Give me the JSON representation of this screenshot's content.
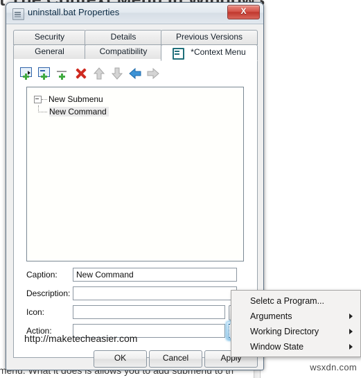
{
  "background": {
    "heading": "it The Context Menu In Windows",
    "body": "t menu. What it does is allows you to add submenu to th",
    "watermark": "wsxdn.com"
  },
  "dialog": {
    "title": "uninstall.bat Properties",
    "title_icon": "script-file-icon",
    "close_label": "X",
    "tabs_row1": [
      {
        "label": "Security",
        "active": false
      },
      {
        "label": "Details",
        "active": false
      },
      {
        "label": "Previous Versions",
        "active": false
      }
    ],
    "tabs_row2": [
      {
        "label": "General",
        "active": false
      },
      {
        "label": "Compatibility",
        "active": false
      },
      {
        "label": "*Context Menu",
        "active": true,
        "icon": "context-menu-icon"
      }
    ],
    "toolbar": [
      {
        "name": "add-submenu-button",
        "tooltip": "Add Submenu",
        "enabled": true
      },
      {
        "name": "add-command-button",
        "tooltip": "Add Command",
        "enabled": true
      },
      {
        "name": "add-separator-button",
        "tooltip": "Add Separator",
        "enabled": true
      },
      {
        "name": "delete-button",
        "tooltip": "Delete",
        "enabled": true
      },
      {
        "name": "move-up-button",
        "tooltip": "Move Up",
        "enabled": false
      },
      {
        "name": "move-down-button",
        "tooltip": "Move Down",
        "enabled": false
      },
      {
        "name": "move-left-button",
        "tooltip": "Move Left",
        "enabled": true
      },
      {
        "name": "move-right-button",
        "tooltip": "Move Right",
        "enabled": false
      }
    ],
    "tree": {
      "root_label": "New Submenu",
      "child_label": "New Command",
      "selected": "New Command"
    },
    "fields": {
      "caption_label": "Caption:",
      "caption_value": "New Command",
      "description_label": "Description:",
      "description_value": "",
      "icon_label": "Icon:",
      "icon_value": "",
      "icon_browse_label": "...",
      "action_label": "Action:",
      "action_value": ""
    },
    "panel_url": "http://maketecheasier.com",
    "footer": {
      "ok_label": "OK",
      "cancel_label": "Cancel",
      "apply_label": "Apply"
    }
  },
  "context_menu": {
    "items": [
      {
        "label": "Seletc a Program...",
        "submenu": false
      },
      {
        "label": "Arguments",
        "submenu": true
      },
      {
        "label": "Working Directory",
        "submenu": true
      },
      {
        "label": "Window State",
        "submenu": true
      }
    ]
  },
  "colors": {
    "accent_blue": "#2f63a8",
    "green_plus": "#3faa3f",
    "delete_red": "#cf2a20",
    "close_red": "#c0382e",
    "tab_icon_teal": "#1f6f7a"
  }
}
